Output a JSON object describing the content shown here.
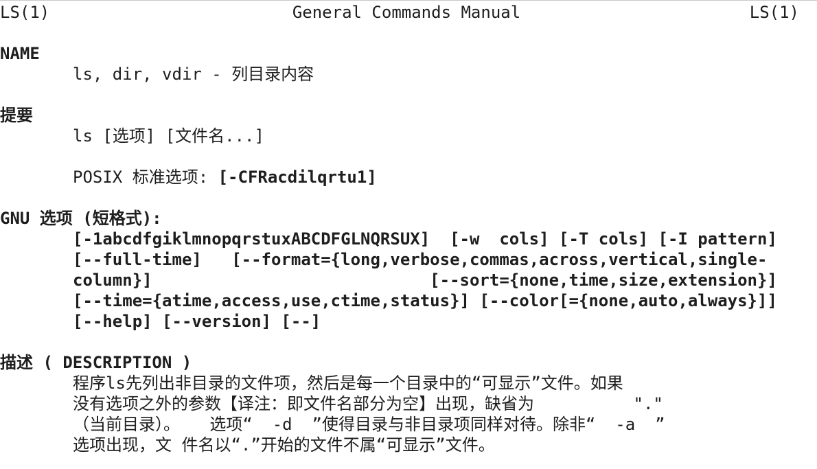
{
  "header": {
    "left": "LS(1)",
    "center": "General Commands Manual",
    "right": "LS(1)"
  },
  "sections": {
    "name": {
      "heading": "NAME",
      "text": "ls, dir, vdir - 列目录内容"
    },
    "synopsis": {
      "heading": "提要",
      "usage": "ls [选项] [文件名...]",
      "posix_label": "POSIX 标准选项: ",
      "posix_options": "[-CFRacdilqrtu1]"
    },
    "gnu_options": {
      "heading": "GNU 选项 (短格式):",
      "lines": [
        "[-1abcdfgiklmnopqrstuxABCDFGLNQRSUX]  [-w  cols] [-T cols] [-I pattern]",
        "[--full-time]   [--format={long,verbose,commas,across,vertical,single-",
        "column}]                            [--sort={none,time,size,extension}]",
        "[--time={atime,access,use,ctime,status}] [--color[={none,auto,always}]]",
        "[--help] [--version] [--]"
      ]
    },
    "description": {
      "heading": "描述 ( DESCRIPTION )",
      "lines": [
        "程序ls先列出非目录的文件项，然后是每一个目录中的“可显示”文件。如果",
        "没有选项之外的参数【译注：即文件名部分为空】出现，缺省为          \".\"",
        "（当前目录）。   选项“  -d  ”使得目录与非目录项同样对待。除非“  -a  ”",
        "选项出现，文 件名以“.”开始的文件不属“可显示”文件。"
      ]
    }
  }
}
